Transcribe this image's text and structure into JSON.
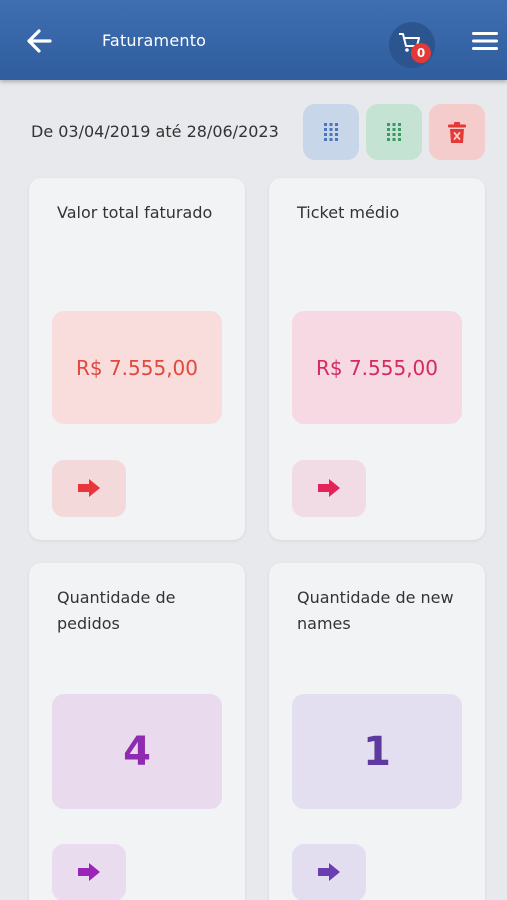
{
  "header": {
    "title": "Faturamento",
    "cart_count": "0"
  },
  "filters": {
    "date_range": "De 03/04/2019 até 28/06/2023"
  },
  "cards": [
    {
      "title": "Valor total faturado",
      "value": "R$ 7.555,00",
      "color": "#e2483b",
      "box_bg": "#f9dcdc",
      "btn_bg": "#f4d9db"
    },
    {
      "title": "Ticket médio",
      "value": "R$ 7.555,00",
      "color": "#d42a5c",
      "box_bg": "#f7d9e3",
      "btn_bg": "#f1dbe4"
    },
    {
      "title": "Quantidade de pedidos",
      "value": "4",
      "color": "#8e2bb0",
      "box_bg": "#eadaee",
      "btn_bg": "#e9dcef"
    },
    {
      "title": "Quantidade de new names",
      "value": "1",
      "color": "#5d3a9e",
      "box_bg": "#e3dff0",
      "btn_bg": "#e2def0"
    }
  ],
  "colors": {
    "appbar": "#3f6fb1",
    "grid_blue": "#4a76bd",
    "grid_green": "#3a9a63",
    "delete_red": "#e53935"
  },
  "icons": [
    "arrow-left-icon",
    "cart-icon",
    "hamburger-menu-icon",
    "grid-icon",
    "trash-icon",
    "arrow-right-icon"
  ]
}
